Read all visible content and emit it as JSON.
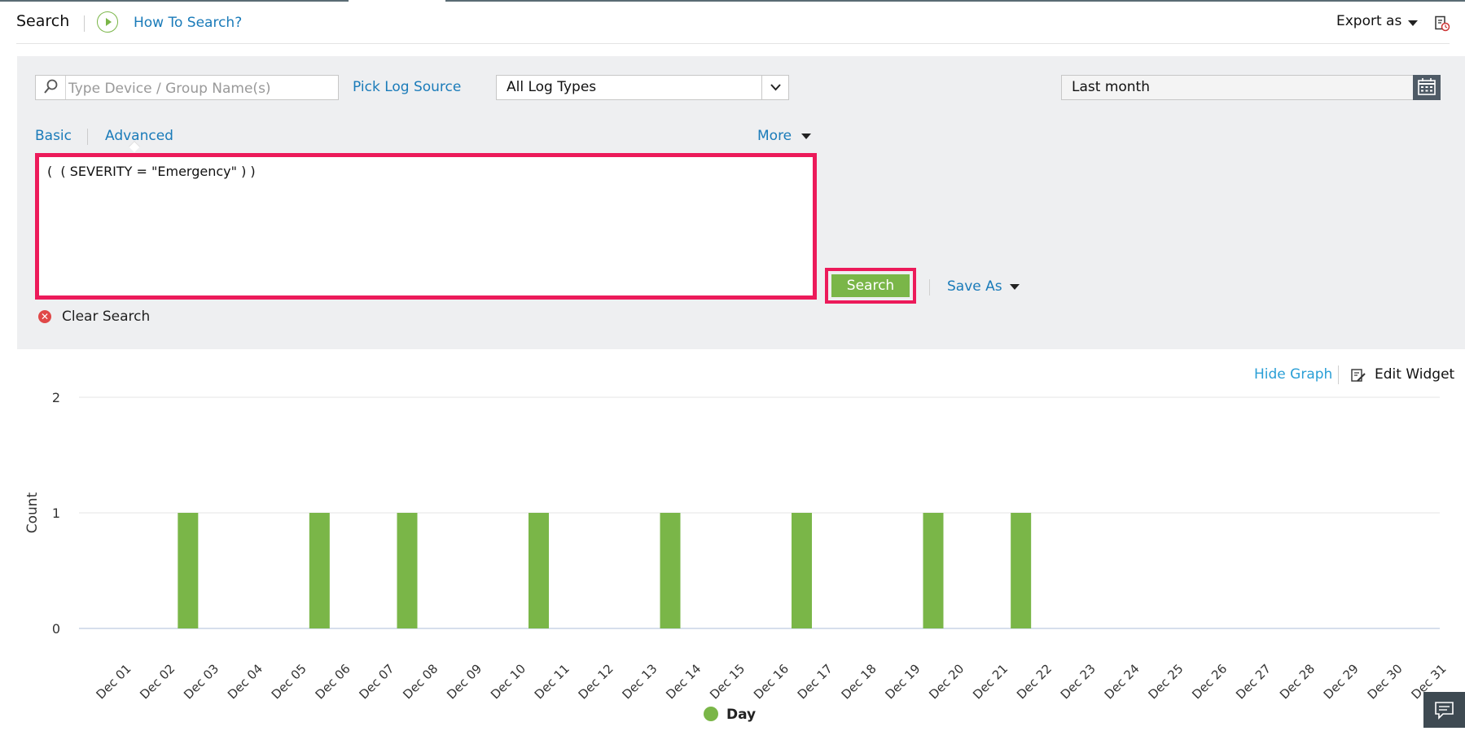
{
  "header": {
    "title": "Search",
    "help_link": "How To Search?",
    "export_label": "Export as"
  },
  "search_panel": {
    "device_placeholder": "Type Device / Group Name(s)",
    "pick_log_source": "Pick Log Source",
    "log_type": "All Log Types",
    "time_range": "Last month",
    "tabs": [
      "Basic",
      "Advanced"
    ],
    "active_tab": "Advanced",
    "more_label": "More",
    "query": "(  ( SEVERITY = \"Emergency\" ) )",
    "search_button": "Search",
    "save_as_label": "Save As",
    "clear_search": "Clear Search"
  },
  "graph_toolbar": {
    "hide_graph": "Hide Graph",
    "edit_widget": "Edit Widget"
  },
  "colors": {
    "accent_link": "#1a7bb9",
    "bar_green": "#7ab648",
    "highlight_red": "#ec1a5a"
  },
  "chart_data": {
    "type": "bar",
    "ylabel": "Count",
    "ylim": [
      0,
      2
    ],
    "yticks": [
      0,
      1,
      2
    ],
    "grid": true,
    "legend": "bottom-center",
    "categories": [
      "Dec 01",
      "Dec 02",
      "Dec 03",
      "Dec 04",
      "Dec 05",
      "Dec 06",
      "Dec 07",
      "Dec 08",
      "Dec 09",
      "Dec 10",
      "Dec 11",
      "Dec 12",
      "Dec 13",
      "Dec 14",
      "Dec 15",
      "Dec 16",
      "Dec 17",
      "Dec 18",
      "Dec 19",
      "Dec 20",
      "Dec 21",
      "Dec 22",
      "Dec 23",
      "Dec 24",
      "Dec 25",
      "Dec 26",
      "Dec 27",
      "Dec 28",
      "Dec 29",
      "Dec 30",
      "Dec 31"
    ],
    "series": [
      {
        "name": "Day",
        "color": "#7ab648",
        "values": [
          0,
          1,
          0,
          0,
          1,
          0,
          1,
          0,
          0,
          1,
          0,
          0,
          1,
          0,
          0,
          1,
          0,
          0,
          1,
          0,
          1,
          0,
          0,
          0,
          0,
          0,
          0,
          0,
          0,
          0,
          0
        ]
      }
    ]
  }
}
